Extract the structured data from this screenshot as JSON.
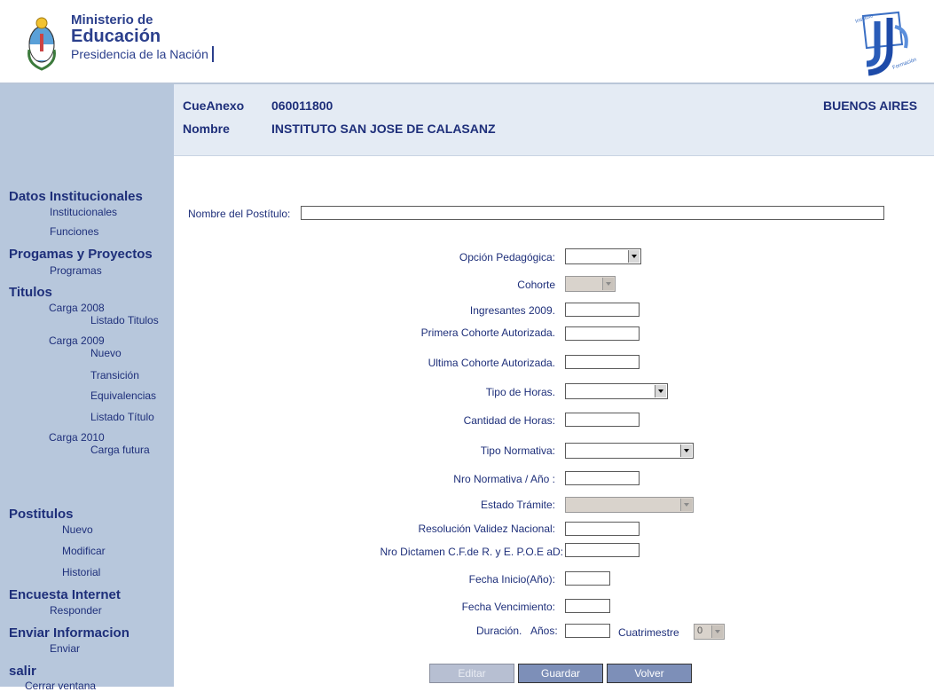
{
  "header": {
    "ministry_line1": "Ministerio de",
    "ministry_line2": "Educación",
    "ministry_line3": "Presidencia de la Nación",
    "logo_left_icon": "argentina-coat-of-arms-icon",
    "logo_right_icon": "instituto-nacional-formacion-docente-logo",
    "brand_color": "#2b3f8c"
  },
  "info": {
    "cue_label": "CueAnexo",
    "cue_value": "060011800",
    "province": "BUENOS AIRES",
    "nombre_label": "Nombre",
    "nombre_value": "INSTITUTO SAN JOSE DE CALASANZ"
  },
  "sidebar": {
    "datos_title": "Datos Institucionales",
    "institucionales": "Institucionales",
    "funciones": "Funciones",
    "programas_title": "Progamas y Proyectos",
    "programas": "Programas",
    "titulos_title": "Titulos",
    "carga2008": "Carga 2008",
    "listado_titulos": "Listado Titulos",
    "carga2009": "Carga 2009",
    "nuevo": "Nuevo",
    "transicion": "Transición",
    "equivalencias": "Equivalencias",
    "listado_titulo": "Listado Título",
    "carga2010": "Carga 2010",
    "carga_futura": "Carga futura",
    "postitulos_title": "Postitulos",
    "post_nuevo": "Nuevo",
    "modificar": "Modificar",
    "historial": "Historial",
    "encuesta_title": "Encuesta Internet",
    "responder": "Responder",
    "enviar_title": "Enviar Informacion",
    "enviar": "Enviar",
    "salir_title": "salir",
    "cerrar": "Cerrar ventana"
  },
  "form": {
    "nombre_postitulo": "Nombre del Postítulo:",
    "opcion_pedagogica": "Opción Pedagógica:",
    "cohorte": "Cohorte",
    "ingresantes": "Ingresantes 2009.",
    "primera_cohorte": "Primera Cohorte Autorizada.",
    "ultima_cohorte": "Ultima Cohorte Autorizada.",
    "tipo_horas": "Tipo de Horas.",
    "cantidad_horas": "Cantidad de Horas:",
    "tipo_normativa": "Tipo Normativa:",
    "nro_normativa": "Nro Normativa / Año :",
    "estado_tramite": "Estado Trámite:",
    "resolucion": "Resolución Validez Nacional:",
    "dictamen": "Nro Dictamen C.F.de R. y E. P.O.E aD:",
    "fecha_inicio": "Fecha Inicio(Año):",
    "fecha_venc": "Fecha Vencimiento:",
    "duracion": "Duración.",
    "anios": "Años:",
    "cuatrimestre": "Cuatrimestre",
    "cuatrimestre_value": "0"
  },
  "buttons": {
    "editar": "Editar",
    "guardar": "Guardar",
    "volver": "Volver"
  }
}
